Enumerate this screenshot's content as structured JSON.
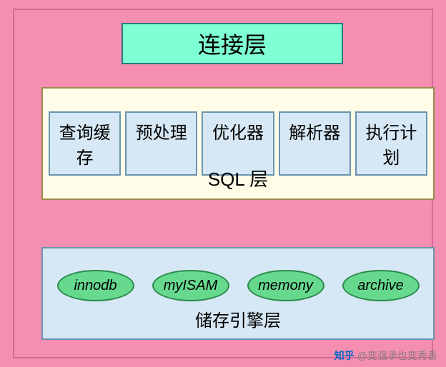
{
  "layers": {
    "connection": {
      "title": "连接层"
    },
    "sql": {
      "title": "SQL 层",
      "items": [
        "查询缓存",
        "预处理",
        "优化器",
        "解析器",
        "执行计划"
      ]
    },
    "storage": {
      "title": "储存引擎层",
      "engines": [
        "innodb",
        "myISAM",
        "memony",
        "archive"
      ]
    }
  },
  "watermark": {
    "icon_label": "知乎",
    "text": "@变强承也变秀香"
  },
  "colors": {
    "bg": "#f48fb1",
    "connection_bg": "#7fffd4",
    "sql_bg": "#fffde7",
    "storage_bg": "#d6e8f5",
    "engine_bg": "#66d98e"
  }
}
